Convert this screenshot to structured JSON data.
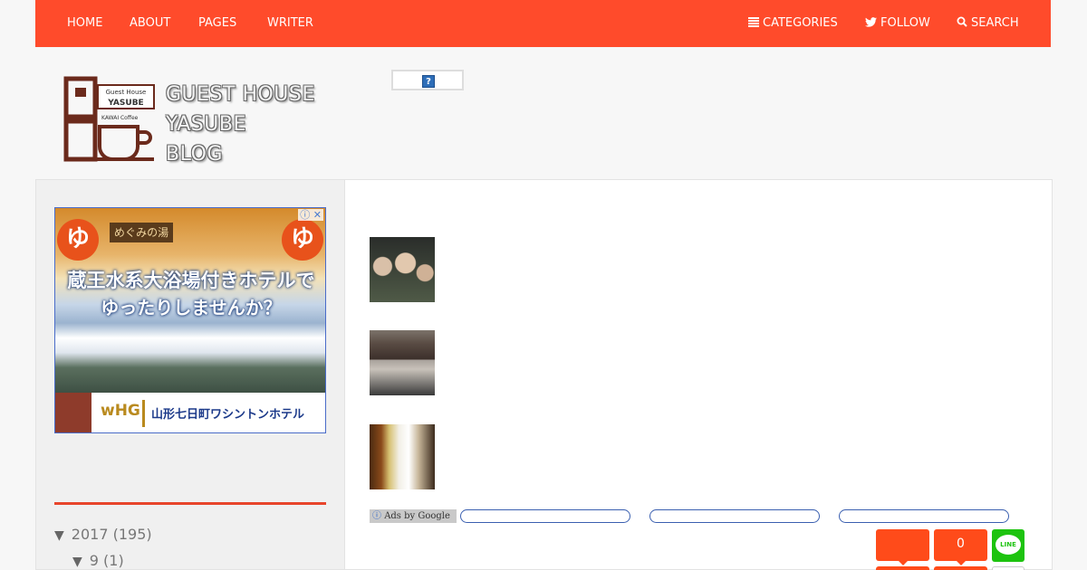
{
  "nav": {
    "left": [
      "HOME",
      "ABOUT",
      "PAGES",
      "WRITER"
    ],
    "categories": "CATEGORIES",
    "follow": "FOLLOW",
    "search": "SEARCH"
  },
  "logo": {
    "line1": "GUEST HOUSE",
    "line2": "YASUBE",
    "line3": "BLOG",
    "sign_top": "Guest House",
    "sign_name": "YASUBE",
    "sign_sub": "KAWAI Coffee"
  },
  "header_widget": {
    "icon": "?"
  },
  "sidebar_ad": {
    "sign": "めぐみの湯",
    "yu": "ゆ",
    "headline1": "蔵王水系大浴場付きホテルで",
    "headline2": "ゆったりしませんか？",
    "brand": "wHG",
    "hotel": "山形七日町ワシントンホテル",
    "choice_icons": "ⓘ ✕"
  },
  "archive": {
    "year": "2017 (195)",
    "month": "9 (1)"
  },
  "main": {
    "ads_label": "Ads by Google",
    "share_count": "0"
  },
  "colors": {
    "accent": "#ff4b2b",
    "line_green": "#1dc30f",
    "link_blue": "#3a5fb0"
  },
  "icons": {
    "categories": "list-icon",
    "follow": "twitter-icon",
    "search": "search-icon",
    "line": "line-icon",
    "info": "info-icon"
  }
}
